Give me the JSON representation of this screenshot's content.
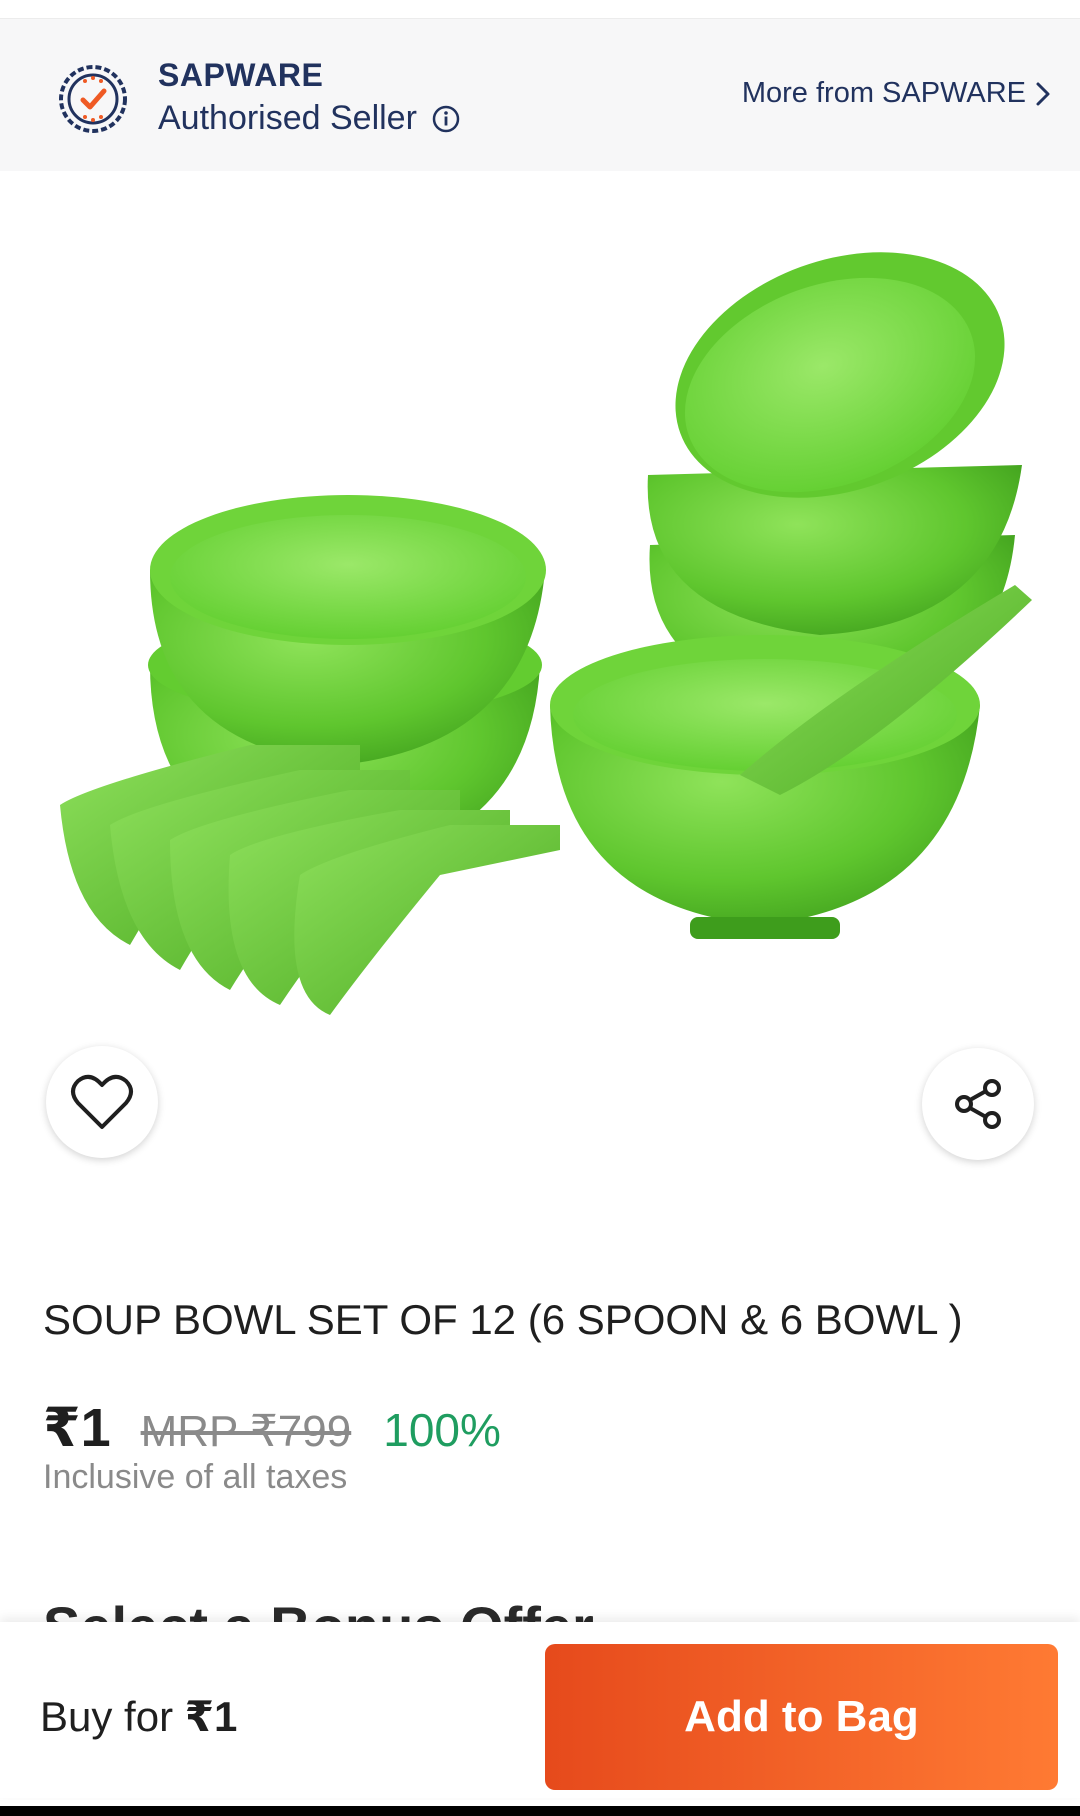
{
  "seller": {
    "name": "SAPWARE",
    "status": "Authorised Seller",
    "more_link": "More from SAPWARE",
    "badge_icon": "verified-seller-badge-icon",
    "info_icon": "info-icon"
  },
  "product": {
    "image_description_icon": "product-image",
    "title": "SOUP BOWL SET OF 12 (6 SPOON & 6 BOWL )",
    "price": "₹1",
    "mrp": "MRP ₹799",
    "discount": "100%",
    "tax_note": "Inclusive of all taxes"
  },
  "actions": {
    "wishlist_icon": "heart-icon",
    "share_icon": "share-icon"
  },
  "partial_section_heading": "Select a Bonus Offer",
  "bottom_bar": {
    "buy_prefix": "Buy for ",
    "buy_price": "₹1",
    "add_to_bag": "Add to Bag"
  },
  "colors": {
    "accent_start": "#e64a1c",
    "accent_end": "#ff7a33",
    "seller_text": "#21325e",
    "discount": "#1f9d60"
  }
}
